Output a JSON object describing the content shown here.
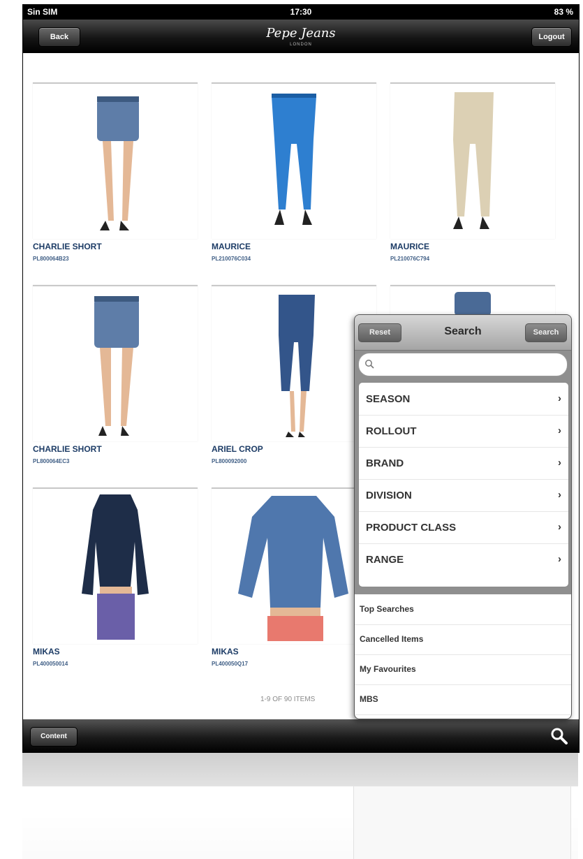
{
  "status_bar": {
    "carrier": "Sin SIM",
    "time": "17:30",
    "battery": "83 %"
  },
  "nav": {
    "back_label": "Back",
    "brand": "Pepe Jeans",
    "brand_sub": "LONDON",
    "logout_label": "Logout"
  },
  "products": [
    {
      "name": "CHARLIE SHORT",
      "code": "PL800064B23"
    },
    {
      "name": "MAURICE",
      "code": "PL210076C034"
    },
    {
      "name": "MAURICE",
      "code": "PL210076C794"
    },
    {
      "name": "CHARLIE SHORT",
      "code": "PL800064EC3"
    },
    {
      "name": "ARIEL CROP",
      "code": "PL800092000"
    },
    {
      "name": "",
      "code": ""
    },
    {
      "name": "MIKAS",
      "code": "PL400050014"
    },
    {
      "name": "MIKAS",
      "code": "PL400050Q17"
    }
  ],
  "pager": {
    "text": "1-9 OF 90 ITEMS"
  },
  "toolbar": {
    "left_label": "Content"
  },
  "search_panel": {
    "title": "Search",
    "reset_label": "Reset",
    "search_label": "Search",
    "input_value": "",
    "filters": [
      "SEASON",
      "ROLLOUT",
      "BRAND",
      "DIVISION",
      "PRODUCT CLASS",
      "RANGE"
    ],
    "links": [
      "Top Searches",
      "Cancelled Items",
      "My Favourites",
      "MBS"
    ]
  },
  "colors": {
    "product_name": "#1d3c66",
    "denim": "#4a6a96",
    "cobalt": "#2e7fd0",
    "beige": "#dcd0b4"
  }
}
